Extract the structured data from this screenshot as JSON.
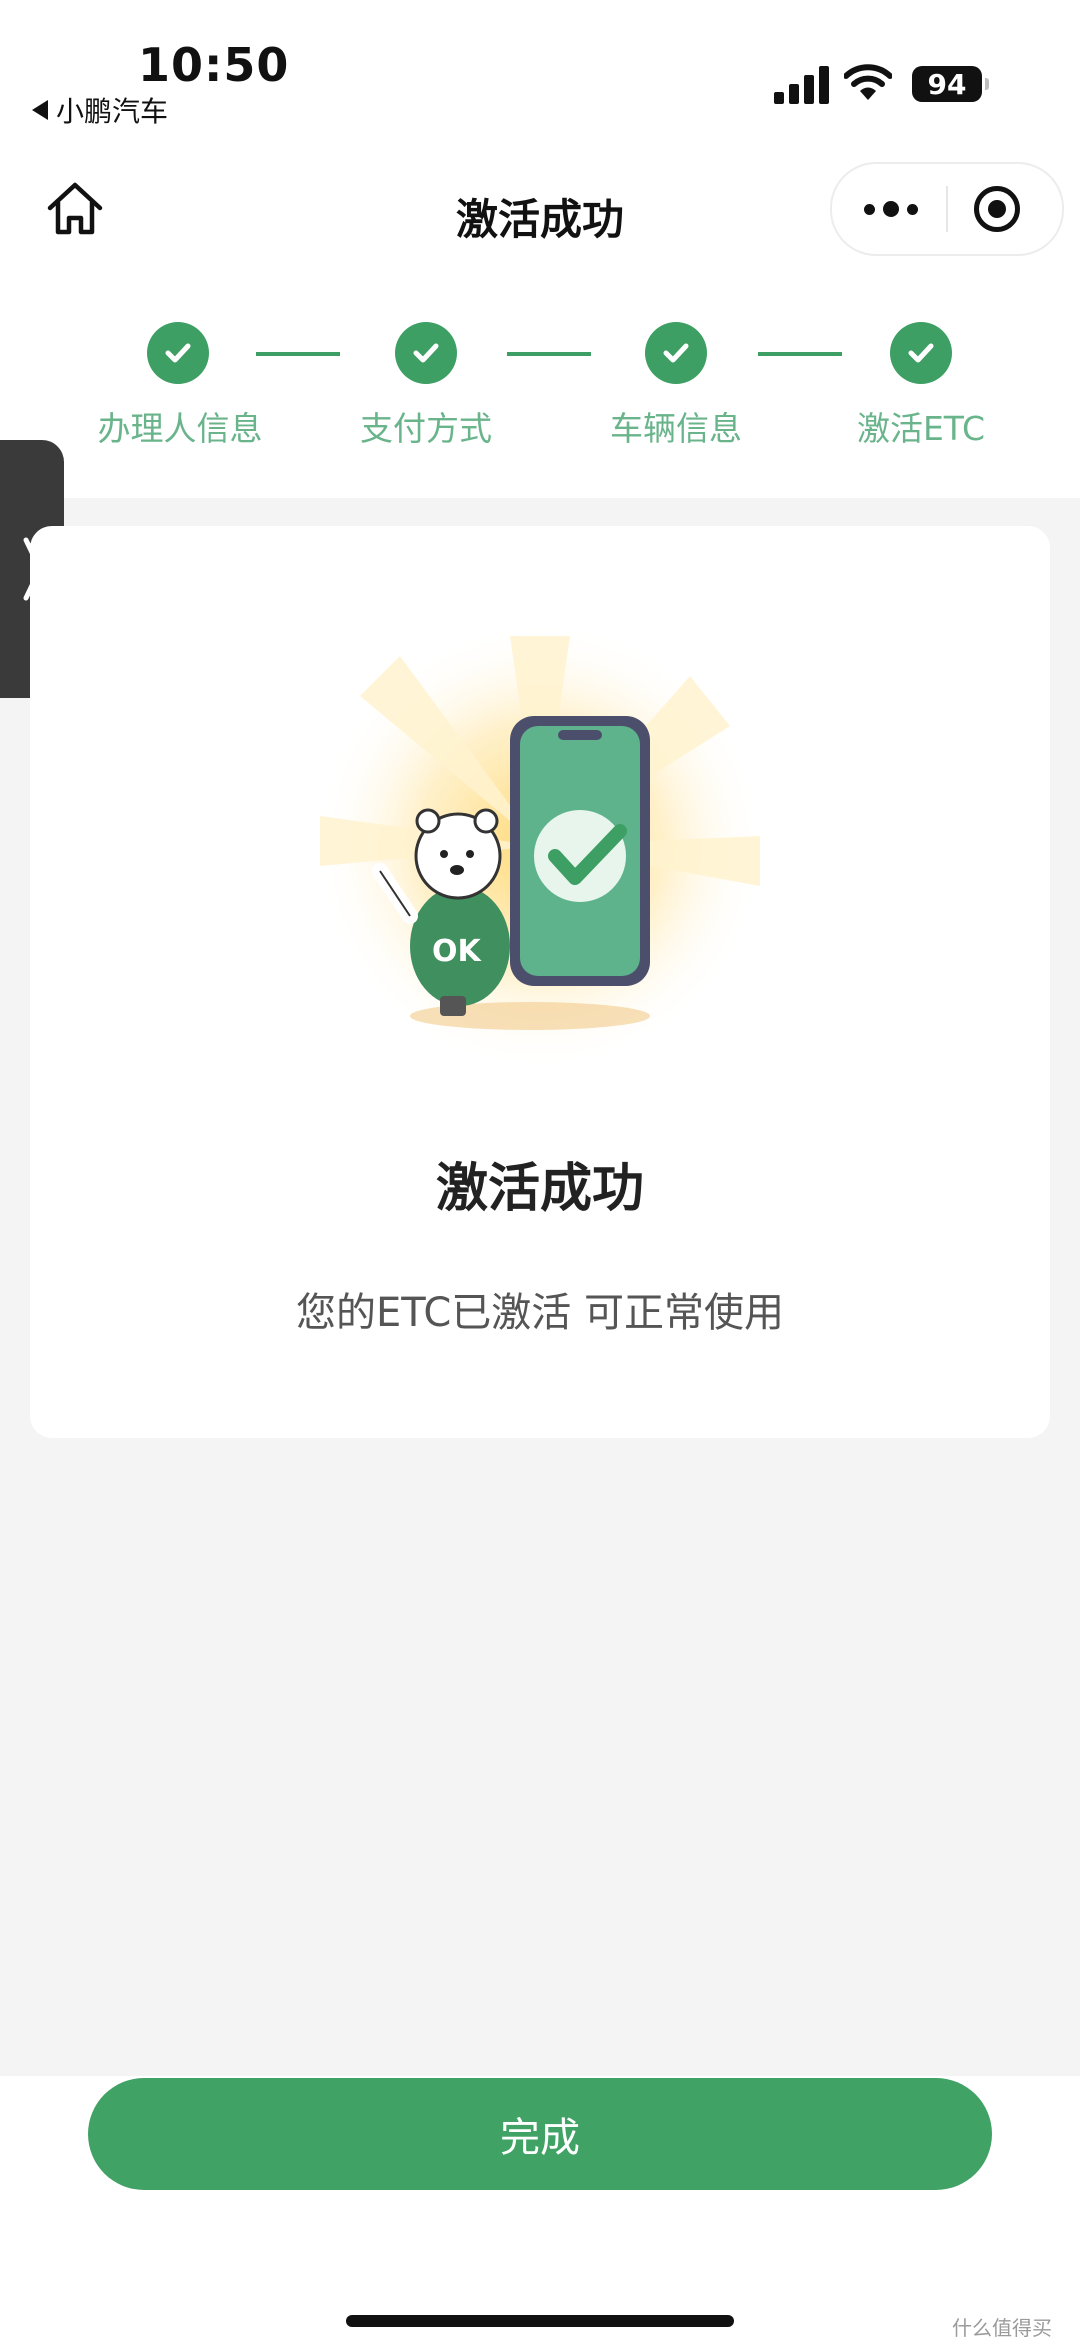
{
  "status_bar": {
    "time": "10:50",
    "back_app": "小鹏汽车",
    "battery": "94"
  },
  "nav": {
    "title": "激活成功"
  },
  "steps": [
    {
      "label": "办理人信息",
      "done": true
    },
    {
      "label": "支付方式",
      "done": true
    },
    {
      "label": "车辆信息",
      "done": true
    },
    {
      "label": "激活ETC",
      "done": true
    }
  ],
  "card": {
    "title": "激活成功",
    "subtitle": "您的ETC已激活 可正常使用",
    "mascot_shirt": "OK"
  },
  "footer": {
    "done_label": "完成",
    "watermark": "什么值得买"
  },
  "colors": {
    "accent": "#41a265",
    "step_text": "#6ab48c",
    "background": "#f4f4f4"
  }
}
